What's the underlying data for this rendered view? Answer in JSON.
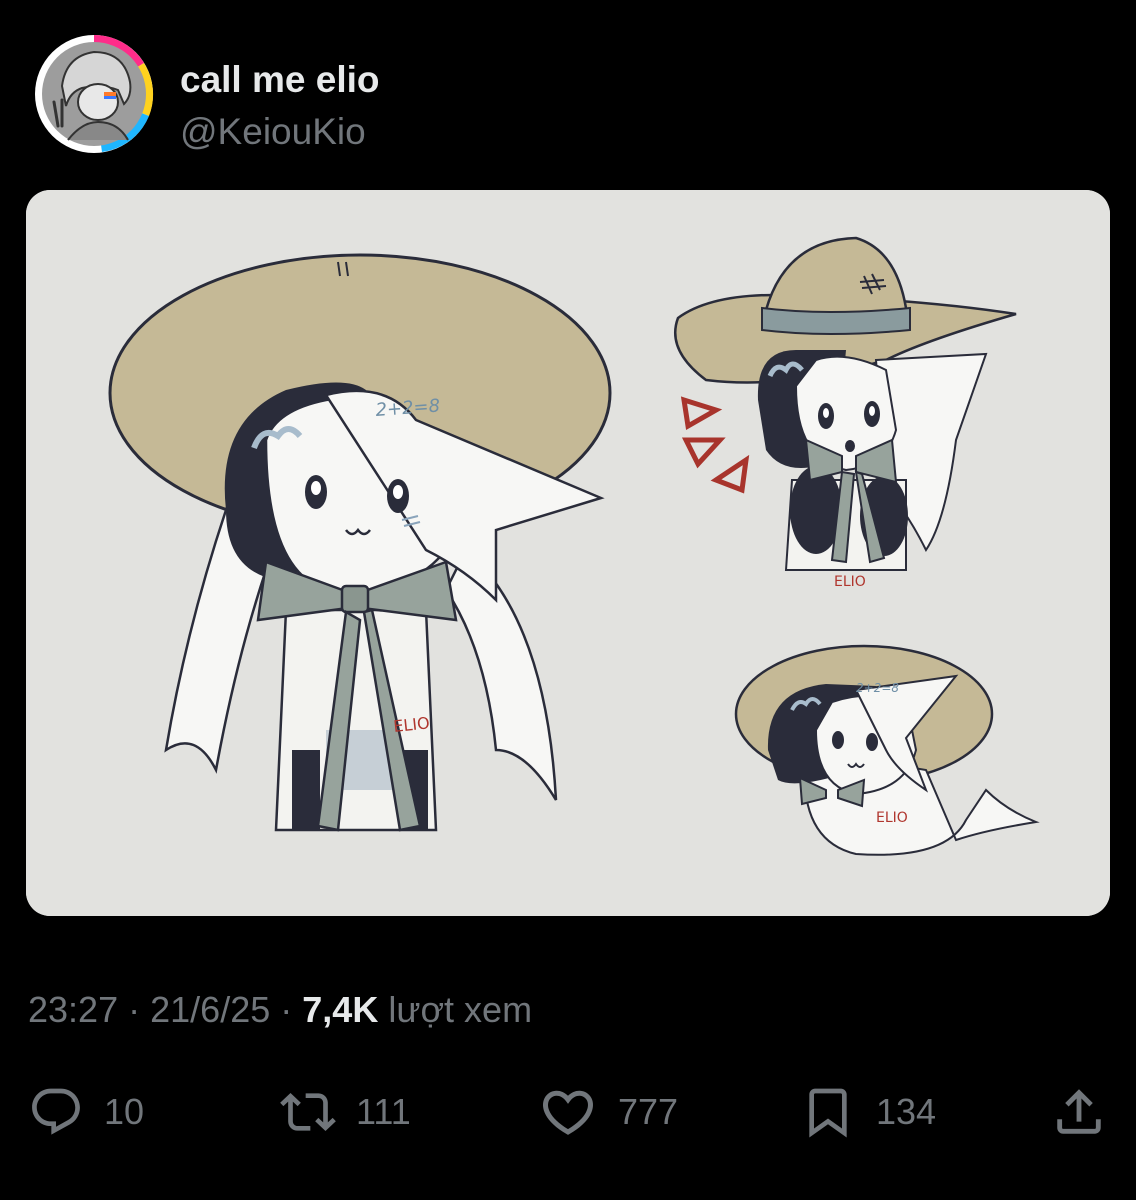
{
  "author": {
    "display_name": "call me elio",
    "handle": "@KeiouKio",
    "avatar_ring_colors": [
      "#ff2d8a",
      "#ffd21f",
      "#1fb6ff"
    ]
  },
  "media": {
    "background": "#e2e2df",
    "labels": {
      "math_large": "2+2=8",
      "math_small": "2+2=8",
      "signature_large": "ELIO",
      "signature_top_right": "ELIO",
      "signature_bottom_right": "ELIO"
    }
  },
  "meta": {
    "time": "23:27",
    "separator": "·",
    "date": "21/6/25",
    "views_count": "7,4K",
    "views_label": "lượt xem"
  },
  "actions": {
    "reply": {
      "icon": "reply-icon",
      "count": "10"
    },
    "repost": {
      "icon": "repost-icon",
      "count": "111"
    },
    "like": {
      "icon": "heart-icon",
      "count": "777"
    },
    "bookmark": {
      "icon": "bookmark-icon",
      "count": "134"
    },
    "share": {
      "icon": "share-icon"
    }
  }
}
